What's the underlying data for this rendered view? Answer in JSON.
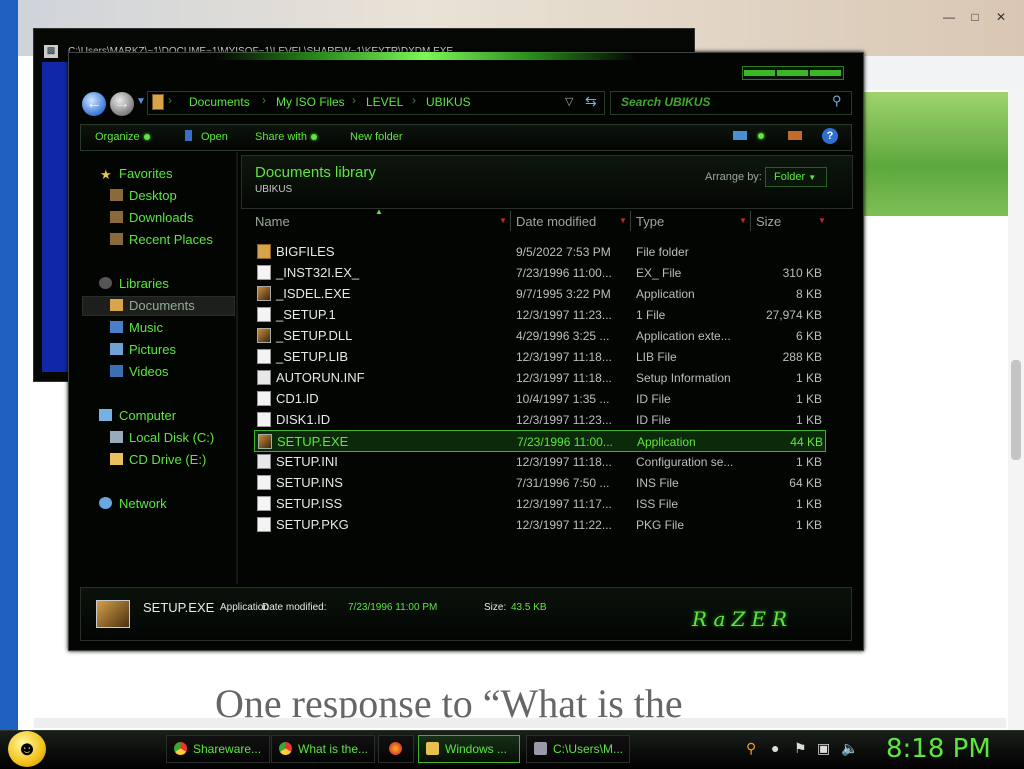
{
  "background": {
    "page_heading": "One response to “What is the",
    "back_window_title": "C:\\Users\\MARKZ\\~1\\DOCUME~1\\MYISOF~1\\LEVEL\\SHAREW~1\\KEYTR\\DXDM.EXE"
  },
  "address": {
    "crumbs": [
      "Documents",
      "My ISO Files",
      "LEVEL",
      "UBIKUS"
    ],
    "search_placeholder": "Search UBIKUS"
  },
  "commands": {
    "organize": "Organize",
    "open": "Open",
    "share_with": "Share with",
    "new_folder": "New folder"
  },
  "nav": {
    "favorites": "Favorites",
    "desktop": "Desktop",
    "downloads": "Downloads",
    "recent_places": "Recent Places",
    "libraries": "Libraries",
    "documents": "Documents",
    "music": "Music",
    "pictures": "Pictures",
    "videos": "Videos",
    "computer": "Computer",
    "local_disk": "Local Disk (C:)",
    "cd_drive": "CD Drive (E:)",
    "network": "Network"
  },
  "library": {
    "title": "Documents library",
    "subtitle": "UBIKUS",
    "arrange_label": "Arrange by:",
    "arrange_value": "Folder"
  },
  "columns": {
    "name": "Name",
    "date_modified": "Date modified",
    "type": "Type",
    "size": "Size"
  },
  "files": [
    {
      "name": "BIGFILES",
      "date": "9/5/2022 7:53 PM",
      "type": "File folder",
      "size": "",
      "icon": "folder"
    },
    {
      "name": "_INST32I.EX_",
      "date": "7/23/1996 11:00...",
      "type": "EX_ File",
      "size": "310 KB",
      "icon": "doc"
    },
    {
      "name": "_ISDEL.EXE",
      "date": "9/7/1995 3:22 PM",
      "type": "Application",
      "size": "8 KB",
      "icon": "app"
    },
    {
      "name": "_SETUP.1",
      "date": "12/3/1997 11:23...",
      "type": "1 File",
      "size": "27,974 KB",
      "icon": "doc"
    },
    {
      "name": "_SETUP.DLL",
      "date": "4/29/1996 3:25 ...",
      "type": "Application exte...",
      "size": "6 KB",
      "icon": "app"
    },
    {
      "name": "_SETUP.LIB",
      "date": "12/3/1997 11:18...",
      "type": "LIB File",
      "size": "288 KB",
      "icon": "doc"
    },
    {
      "name": "AUTORUN.INF",
      "date": "12/3/1997 11:18...",
      "type": "Setup Information",
      "size": "1 KB",
      "icon": "ini"
    },
    {
      "name": "CD1.ID",
      "date": "10/4/1997 1:35 ...",
      "type": "ID File",
      "size": "1 KB",
      "icon": "doc"
    },
    {
      "name": "DISK1.ID",
      "date": "12/3/1997 11:23...",
      "type": "ID File",
      "size": "1 KB",
      "icon": "doc"
    },
    {
      "name": "SETUP.EXE",
      "date": "7/23/1996 11:00...",
      "type": "Application",
      "size": "44 KB",
      "icon": "app",
      "selected": true
    },
    {
      "name": "SETUP.INI",
      "date": "12/3/1997 11:18...",
      "type": "Configuration se...",
      "size": "1 KB",
      "icon": "ini"
    },
    {
      "name": "SETUP.INS",
      "date": "7/31/1996 7:50 ...",
      "type": "INS File",
      "size": "64 KB",
      "icon": "doc"
    },
    {
      "name": "SETUP.ISS",
      "date": "12/3/1997 11:17...",
      "type": "ISS File",
      "size": "1 KB",
      "icon": "doc"
    },
    {
      "name": "SETUP.PKG",
      "date": "12/3/1997 11:22...",
      "type": "PKG File",
      "size": "1 KB",
      "icon": "doc"
    }
  ],
  "details": {
    "name": "SETUP.EXE",
    "type": "Application",
    "date_label": "Date modified:",
    "date_value": "7/23/1996 11:00 PM",
    "size_label": "Size:",
    "size_value": "43.5 KB",
    "logo": "RaZER"
  },
  "taskbar": {
    "buttons": [
      {
        "label": "Shareware..."
      },
      {
        "label": "What is the..."
      },
      {
        "label": "Windows ..."
      },
      {
        "label": "C:\\Users\\M..."
      }
    ],
    "clock": "8:18 PM"
  },
  "colors": {
    "accent": "#5de63f",
    "window_bg": "#030503",
    "taskbar_bg": "#000000"
  }
}
